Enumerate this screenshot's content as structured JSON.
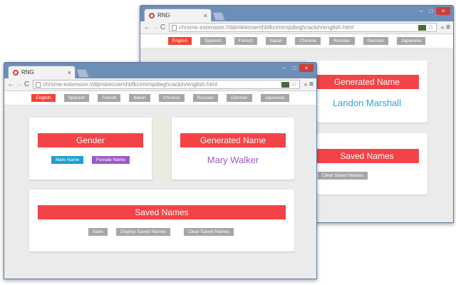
{
  "browser": {
    "tab_title": "RNG",
    "tab_close": "×",
    "url": "chrome-extension://dijimkiecoemhbfkcmnmpdieghcackin/english.html",
    "nav_back": "←",
    "nav_forward": "→",
    "nav_reload": "C",
    "star": "☆",
    "extensions": "»",
    "menu": "≡",
    "win_minimize": "–",
    "win_maximize": "□",
    "win_close": "×"
  },
  "languages": [
    "English",
    "Spanish",
    "French",
    "Italian",
    "Chinese",
    "Russian",
    "German",
    "Japanese"
  ],
  "active_language": "English",
  "gender": {
    "title": "Gender",
    "male_label": "Male Name",
    "female_label": "Female Name"
  },
  "generated": {
    "title": "Generated Name",
    "front_name": "Mary Walker",
    "back_name": "Landon Marshall"
  },
  "saved": {
    "title": "Saved Names",
    "save_label": "Save",
    "display_label": "Display Saved Names",
    "clear_label": "Clear Saved Names"
  },
  "colors": {
    "accent_red": "#f44346",
    "male_blue": "#1ea0d2",
    "female_purple": "#9c59c8",
    "back_name_color": "#2aa6d6",
    "front_name_color": "#9c59c8"
  }
}
